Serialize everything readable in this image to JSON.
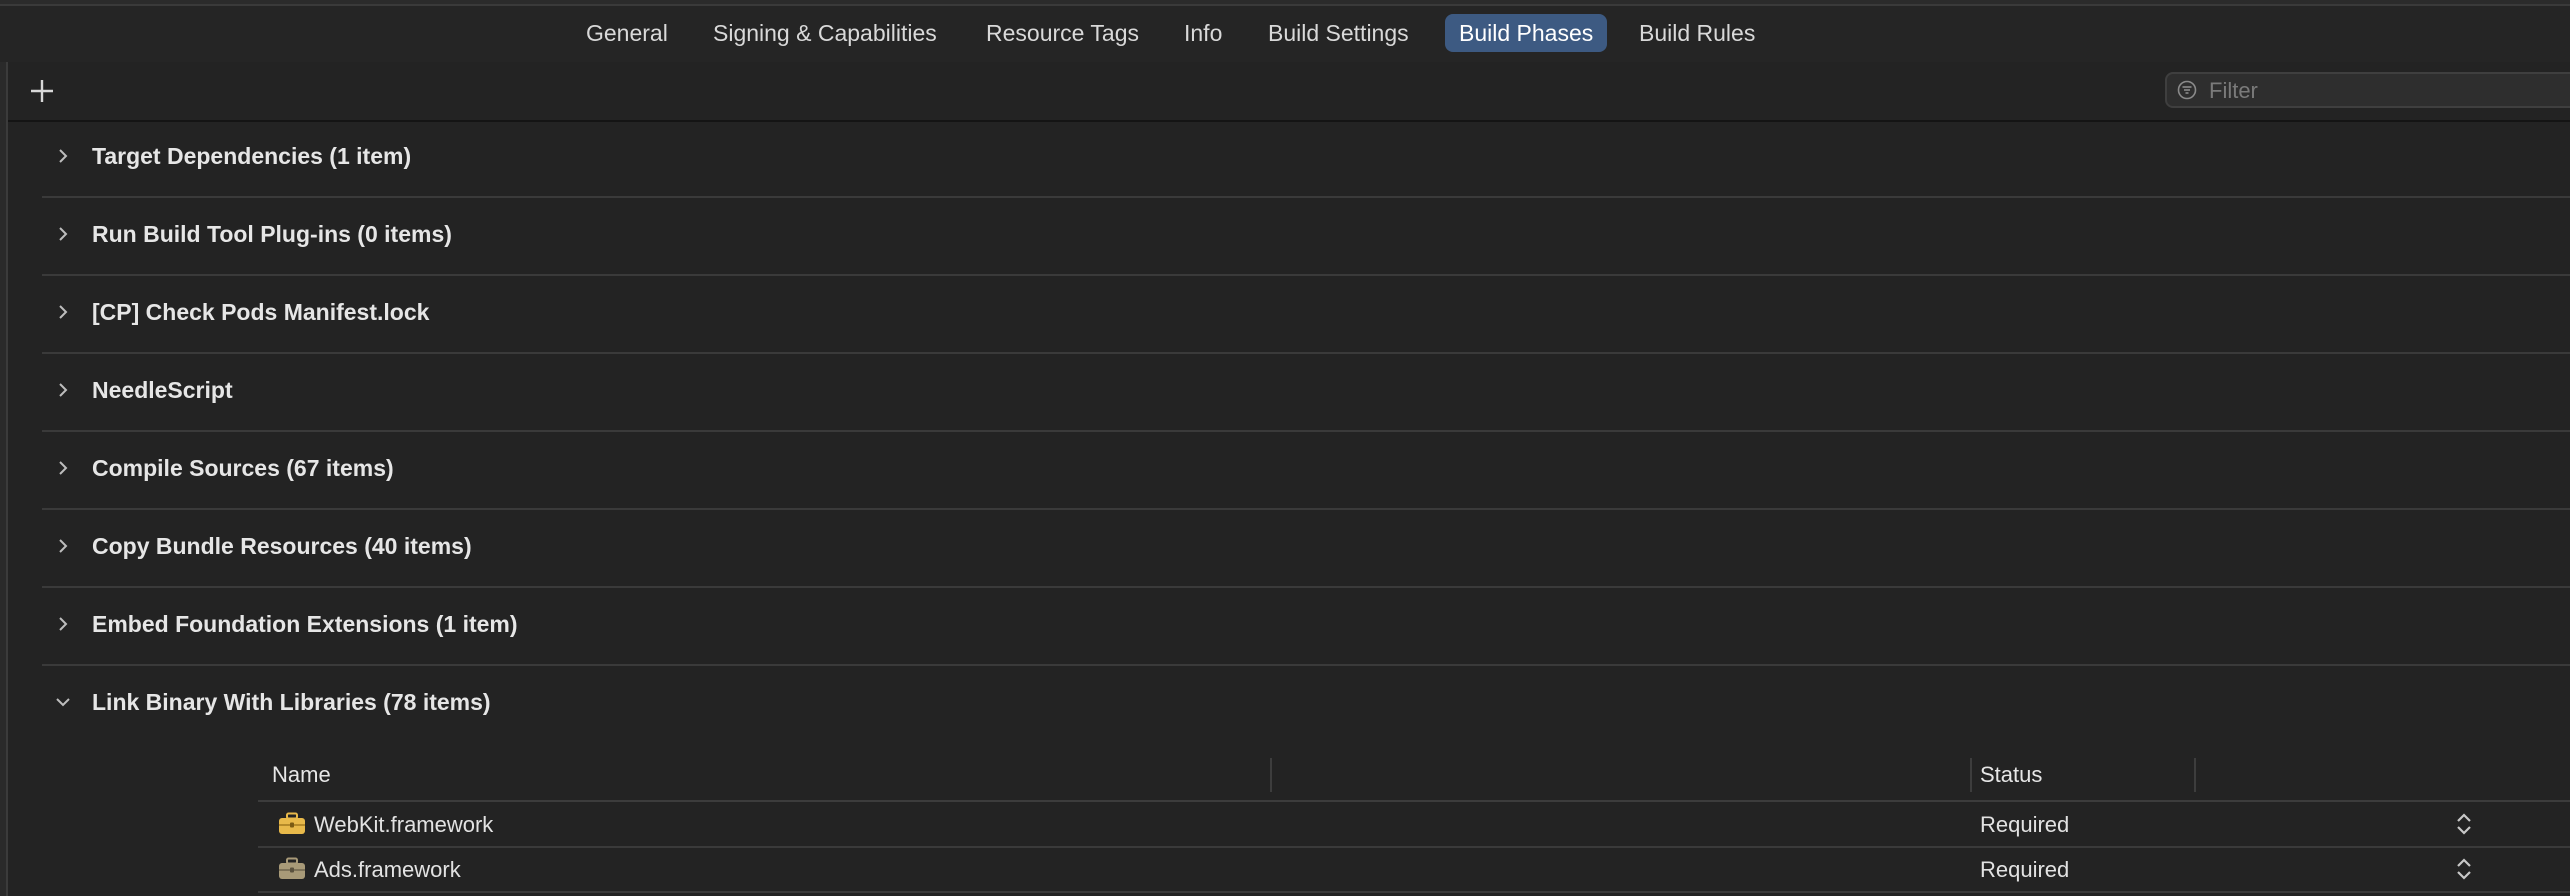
{
  "tabs": [
    {
      "label": "General",
      "active": false
    },
    {
      "label": "Signing & Capabilities",
      "active": false
    },
    {
      "label": "Resource Tags",
      "active": false
    },
    {
      "label": "Info",
      "active": false
    },
    {
      "label": "Build Settings",
      "active": false
    },
    {
      "label": "Build Phases",
      "active": true
    },
    {
      "label": "Build Rules",
      "active": false
    }
  ],
  "toolbar": {
    "add_icon": "plus-icon",
    "filter_placeholder": "Filter",
    "filter_icon": "filter-icon"
  },
  "phases": [
    {
      "label": "Target Dependencies (1 item)",
      "expanded": false
    },
    {
      "label": "Run Build Tool Plug-ins (0 items)",
      "expanded": false
    },
    {
      "label": "[CP] Check Pods Manifest.lock",
      "expanded": false
    },
    {
      "label": "NeedleScript",
      "expanded": false
    },
    {
      "label": "Compile Sources (67 items)",
      "expanded": false
    },
    {
      "label": "Copy Bundle Resources (40 items)",
      "expanded": false
    },
    {
      "label": "Embed Foundation Extensions (1 item)",
      "expanded": false
    },
    {
      "label": "Link Binary With Libraries (78 items)",
      "expanded": true
    }
  ],
  "libraries": {
    "columns": {
      "name": "Name",
      "status": "Status"
    },
    "rows": [
      {
        "name": "WebKit.framework",
        "status": "Required",
        "icon": "toolbox-icon"
      },
      {
        "name": "Ads.framework",
        "status": "Required",
        "icon": "toolbox-icon"
      }
    ]
  },
  "colors": {
    "background": "#232323",
    "active_tab": "#3d5a82",
    "framework_icon": "#e8b94a"
  }
}
